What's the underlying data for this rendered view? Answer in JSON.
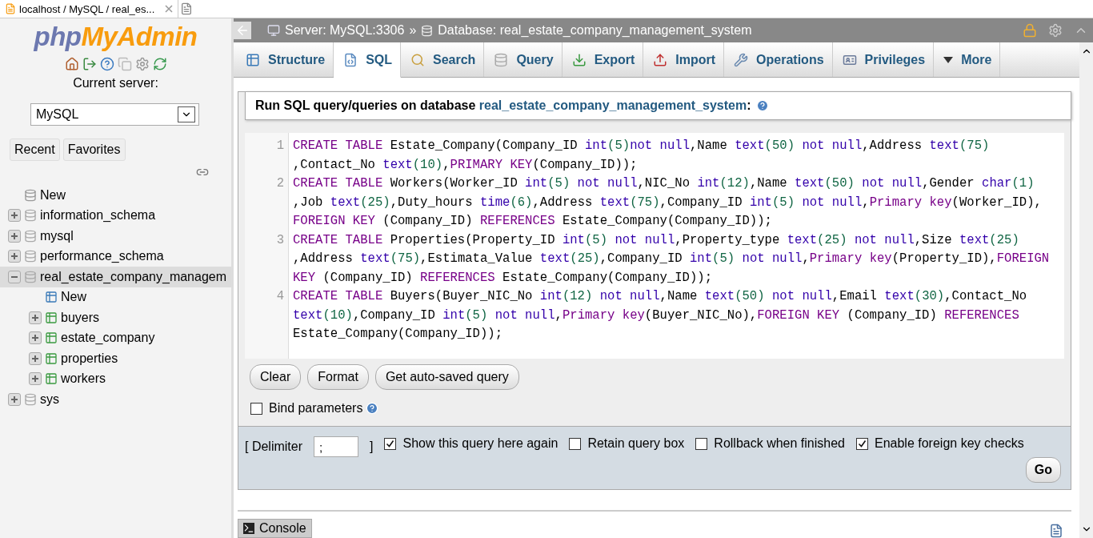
{
  "browser_tab": {
    "title": "localhost / MySQL / real_es..."
  },
  "sidebar": {
    "logo": {
      "php": "php",
      "myadmin": "MyAdmin"
    },
    "current_server_label": "Current server:",
    "server_select": {
      "value": "MySQL"
    },
    "buttons": [
      "Recent",
      "Favorites"
    ],
    "tree": [
      {
        "label": "New",
        "kind": "new"
      },
      {
        "label": "information_schema",
        "kind": "db",
        "expanded": false,
        "selected": false
      },
      {
        "label": "mysql",
        "kind": "db",
        "expanded": false,
        "selected": false
      },
      {
        "label": "performance_schema",
        "kind": "db",
        "expanded": false,
        "selected": false
      },
      {
        "label": "real_estate_company_managem",
        "kind": "db",
        "expanded": true,
        "selected": true,
        "children": [
          {
            "label": "New",
            "kind": "newtable"
          },
          {
            "label": "buyers",
            "kind": "table",
            "expanded": false
          },
          {
            "label": "estate_company",
            "kind": "table",
            "expanded": false
          },
          {
            "label": "properties",
            "kind": "table",
            "expanded": false
          },
          {
            "label": "workers",
            "kind": "table",
            "expanded": false
          }
        ]
      },
      {
        "label": "sys",
        "kind": "db",
        "expanded": false,
        "selected": false
      }
    ]
  },
  "breadcrumb": {
    "server": "Server: MySQL:3306",
    "separator": "»",
    "database": "Database: real_estate_company_management_system"
  },
  "tabs": [
    {
      "label": "Structure",
      "selected": false
    },
    {
      "label": "SQL",
      "selected": true
    },
    {
      "label": "Search",
      "selected": false
    },
    {
      "label": "Query",
      "selected": false
    },
    {
      "label": "Export",
      "selected": false
    },
    {
      "label": "Import",
      "selected": false
    },
    {
      "label": "Operations",
      "selected": false
    },
    {
      "label": "Privileges",
      "selected": false
    },
    {
      "label": "More",
      "selected": false
    }
  ],
  "query_panel": {
    "title": "Run SQL query/queries on database ",
    "database": "real_estate_company_management_system",
    "title_end": ":",
    "code": [
      {
        "number": "1",
        "tokens": [
          {
            "kind": "keyword",
            "text": "CREATE TABLE"
          },
          {
            "kind": "plain",
            "text": " Estate_Company(Company_ID "
          },
          {
            "kind": "type",
            "text": "int"
          },
          {
            "kind": "number",
            "text": "(5)"
          },
          {
            "kind": "type",
            "text": "not null"
          },
          {
            "kind": "plain",
            "text": ",Name "
          },
          {
            "kind": "type",
            "text": "text"
          },
          {
            "kind": "number",
            "text": "(50)"
          },
          {
            "kind": "type",
            "text": " not null"
          },
          {
            "kind": "plain",
            "text": ",Address "
          },
          {
            "kind": "type",
            "text": "text"
          },
          {
            "kind": "number",
            "text": "(75)"
          },
          {
            "kind": "plain",
            "text": ",Contact_No "
          },
          {
            "kind": "type",
            "text": "text"
          },
          {
            "kind": "number",
            "text": "(10)"
          },
          {
            "kind": "plain",
            "text": ","
          },
          {
            "kind": "keyword",
            "text": "PRIMARY KEY"
          },
          {
            "kind": "plain",
            "text": "(Company_ID));"
          }
        ]
      },
      {
        "number": "2",
        "tokens": [
          {
            "kind": "keyword",
            "text": "CREATE TABLE"
          },
          {
            "kind": "plain",
            "text": " Workers(Worker_ID "
          },
          {
            "kind": "type",
            "text": "int"
          },
          {
            "kind": "number",
            "text": "(5)"
          },
          {
            "kind": "type",
            "text": " not null"
          },
          {
            "kind": "plain",
            "text": ",NIC_No "
          },
          {
            "kind": "type",
            "text": "int"
          },
          {
            "kind": "number",
            "text": "(12)"
          },
          {
            "kind": "plain",
            "text": ",Name "
          },
          {
            "kind": "type",
            "text": "text"
          },
          {
            "kind": "number",
            "text": "(50)"
          },
          {
            "kind": "type",
            "text": " not null"
          },
          {
            "kind": "plain",
            "text": ",Gender "
          },
          {
            "kind": "type",
            "text": "char"
          },
          {
            "kind": "number",
            "text": "(1)"
          },
          {
            "kind": "plain",
            "text": ",Job "
          },
          {
            "kind": "type",
            "text": "text"
          },
          {
            "kind": "number",
            "text": "(25)"
          },
          {
            "kind": "plain",
            "text": ",Duty_hours "
          },
          {
            "kind": "type",
            "text": "time"
          },
          {
            "kind": "number",
            "text": "(6)"
          },
          {
            "kind": "plain",
            "text": ",Address "
          },
          {
            "kind": "type",
            "text": "text"
          },
          {
            "kind": "number",
            "text": "(75)"
          },
          {
            "kind": "plain",
            "text": ",Company_ID "
          },
          {
            "kind": "type",
            "text": "int"
          },
          {
            "kind": "number",
            "text": "(5)"
          },
          {
            "kind": "type",
            "text": " not null"
          },
          {
            "kind": "plain",
            "text": ","
          },
          {
            "kind": "keyword",
            "text": "Primary key"
          },
          {
            "kind": "plain",
            "text": "(Worker_ID),"
          },
          {
            "kind": "keyword",
            "text": "FOREIGN KEY"
          },
          {
            "kind": "plain",
            "text": " (Company_ID) "
          },
          {
            "kind": "keyword",
            "text": "REFERENCES"
          },
          {
            "kind": "plain",
            "text": " Estate_Company(Company_ID));"
          }
        ]
      },
      {
        "number": "3",
        "tokens": [
          {
            "kind": "keyword",
            "text": "CREATE TABLE"
          },
          {
            "kind": "plain",
            "text": " Properties(Property_ID "
          },
          {
            "kind": "type",
            "text": "int"
          },
          {
            "kind": "number",
            "text": "(5)"
          },
          {
            "kind": "type",
            "text": " not null"
          },
          {
            "kind": "plain",
            "text": ",Property_type "
          },
          {
            "kind": "type",
            "text": "text"
          },
          {
            "kind": "number",
            "text": "(25)"
          },
          {
            "kind": "type",
            "text": " not null"
          },
          {
            "kind": "plain",
            "text": ",Size "
          },
          {
            "kind": "type",
            "text": "text"
          },
          {
            "kind": "number",
            "text": "(25)"
          },
          {
            "kind": "plain",
            "text": ",Address "
          },
          {
            "kind": "type",
            "text": "text"
          },
          {
            "kind": "number",
            "text": "(75)"
          },
          {
            "kind": "plain",
            "text": ",Estimata_Value "
          },
          {
            "kind": "type",
            "text": "text"
          },
          {
            "kind": "number",
            "text": "(25)"
          },
          {
            "kind": "plain",
            "text": ",Company_ID "
          },
          {
            "kind": "type",
            "text": "int"
          },
          {
            "kind": "number",
            "text": "(5)"
          },
          {
            "kind": "type",
            "text": " not null"
          },
          {
            "kind": "plain",
            "text": ","
          },
          {
            "kind": "keyword",
            "text": "Primary key"
          },
          {
            "kind": "plain",
            "text": "(Property_ID),"
          },
          {
            "kind": "keyword",
            "text": "FOREIGN KEY"
          },
          {
            "kind": "plain",
            "text": " (Company_ID) "
          },
          {
            "kind": "keyword",
            "text": "REFERENCES"
          },
          {
            "kind": "plain",
            "text": " Estate_Company(Company_ID));"
          }
        ]
      },
      {
        "number": "4",
        "tokens": [
          {
            "kind": "keyword",
            "text": "CREATE TABLE"
          },
          {
            "kind": "plain",
            "text": " Buyers(Buyer_NIC_No "
          },
          {
            "kind": "type",
            "text": "int"
          },
          {
            "kind": "number",
            "text": "(12)"
          },
          {
            "kind": "type",
            "text": " not null"
          },
          {
            "kind": "plain",
            "text": ",Name "
          },
          {
            "kind": "type",
            "text": "text"
          },
          {
            "kind": "number",
            "text": "(50)"
          },
          {
            "kind": "type",
            "text": " not null"
          },
          {
            "kind": "plain",
            "text": ",Email "
          },
          {
            "kind": "type",
            "text": "text"
          },
          {
            "kind": "number",
            "text": "(30)"
          },
          {
            "kind": "plain",
            "text": ",Contact_No "
          },
          {
            "kind": "type",
            "text": "text"
          },
          {
            "kind": "number",
            "text": "(10)"
          },
          {
            "kind": "plain",
            "text": ",Company_ID "
          },
          {
            "kind": "type",
            "text": "int"
          },
          {
            "kind": "number",
            "text": "(5)"
          },
          {
            "kind": "type",
            "text": " not null"
          },
          {
            "kind": "plain",
            "text": ","
          },
          {
            "kind": "keyword",
            "text": "Primary key"
          },
          {
            "kind": "plain",
            "text": "(Buyer_NIC_No),"
          },
          {
            "kind": "keyword",
            "text": "FOREIGN KEY"
          },
          {
            "kind": "plain",
            "text": " (Company_ID) "
          },
          {
            "kind": "keyword",
            "text": "REFERENCES"
          },
          {
            "kind": "plain",
            "text": " Estate_Company(Company_ID));"
          }
        ]
      }
    ],
    "buttons": [
      "Clear",
      "Format",
      "Get auto-saved query"
    ],
    "bind_parameters": {
      "label": "Bind parameters",
      "checked": false
    }
  },
  "options": {
    "delimiter_open": "[ Delimiter",
    "delimiter_value": ";",
    "delimiter_close": "]",
    "checkboxes": [
      {
        "label": "Show this query here again",
        "checked": true
      },
      {
        "label": "Retain query box",
        "checked": false
      },
      {
        "label": "Rollback when finished",
        "checked": false
      },
      {
        "label": "Enable foreign key checks",
        "checked": true
      }
    ],
    "go": "Go"
  },
  "console": {
    "label": "Console"
  }
}
